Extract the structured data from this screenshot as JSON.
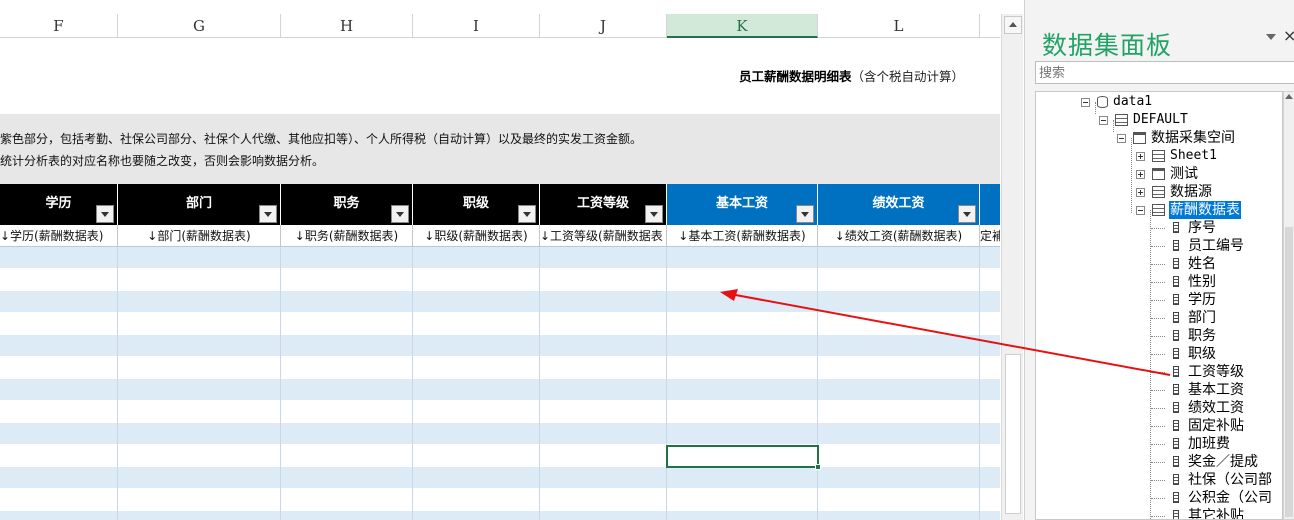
{
  "sheet": {
    "columns": [
      "F",
      "G",
      "H",
      "I",
      "J",
      "K",
      "L"
    ],
    "selected_column": "K",
    "report_title": "员工薪酬数据明细表",
    "report_subtitle": "（含个税自动计算）",
    "description_line1": "紫色部分，包括考勤、社保公司部分、社保个人代缴、其他应扣等）、个人所得税（自动计算）以及最终的实发工资金额。",
    "description_line2": "统计分析表的对应名称也要随之改变，否则会影响数据分析。",
    "headers": [
      {
        "label": "学历",
        "color": "black"
      },
      {
        "label": "部门",
        "color": "black"
      },
      {
        "label": "职务",
        "color": "black"
      },
      {
        "label": "职级",
        "color": "black"
      },
      {
        "label": "工资等级",
        "color": "black"
      },
      {
        "label": "基本工资",
        "color": "blue"
      },
      {
        "label": "绩效工资",
        "color": "blue"
      }
    ],
    "bindings": [
      "↓学历(薪酬数据表)",
      "↓部门(薪酬数据表)",
      "↓职务(薪酬数据表)",
      "↓职级(薪酬数据表)",
      "↓工资等级(薪酬数据表",
      "↓基本工资(薪酬数据表)",
      "↓绩效工资(薪酬数据表)",
      "定補"
    ],
    "colors": {
      "header_black": "#000000",
      "header_blue": "#0070c0",
      "row_alt": "#ddebf7",
      "accent_green": "#217346",
      "arrow": "#e81010"
    }
  },
  "panel": {
    "title": "数据集面板",
    "close_glyph": "×",
    "search_placeholder": "搜索",
    "tree": {
      "datasource": "data1",
      "schema": "DEFAULT",
      "space": "数据采集空间",
      "tables": [
        "Sheet1",
        "测试",
        "数据源"
      ],
      "selected_table": "薪酬数据表",
      "fields": [
        "序号",
        "员工编号",
        "姓名",
        "性别",
        "学历",
        "部门",
        "职务",
        "职级",
        "工资等级",
        "基本工资",
        "绩效工资",
        "固定补贴",
        "加班费",
        "奖金／提成",
        "社保（公司部",
        "公积金（公司",
        "其它补贴"
      ]
    }
  }
}
